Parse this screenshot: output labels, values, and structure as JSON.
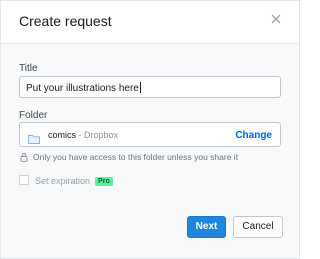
{
  "dialog": {
    "title": "Create request",
    "close_icon": "close-icon"
  },
  "form": {
    "title_label": "Title",
    "title_value": "Put your illustrations here",
    "folder_label": "Folder",
    "folder_icon": "folder-icon",
    "folder_name": "comics",
    "folder_location": " - Dropbox",
    "change_label": "Change",
    "access_note": "Only you have access to this folder unless you share it",
    "lock_icon": "lock-icon",
    "expiration_label": "Set expiration",
    "pro_badge": "Pro"
  },
  "footer": {
    "next_label": "Next",
    "cancel_label": "Cancel"
  },
  "colors": {
    "accent": "#0061fe",
    "primary_button": "#1f86e0",
    "pro_badge_bg": "#5ff0a0"
  }
}
